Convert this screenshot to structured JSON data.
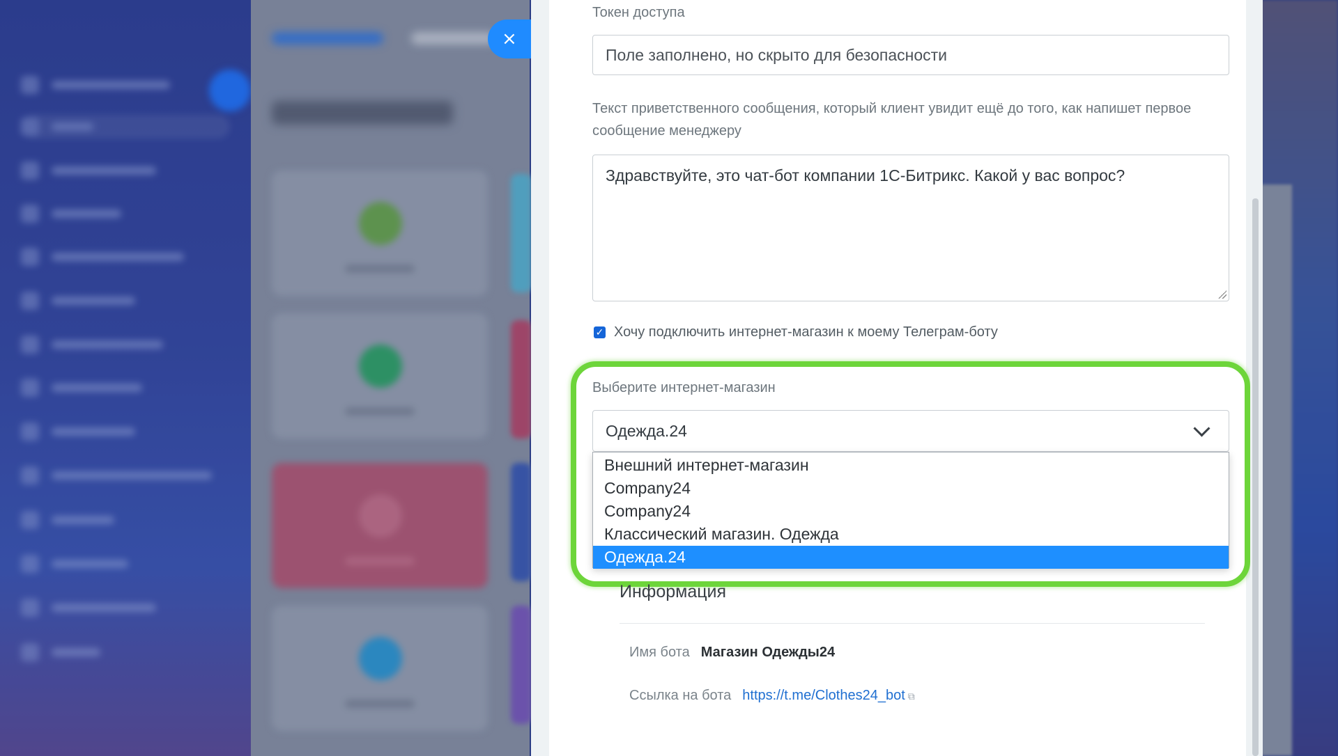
{
  "close_button": {
    "icon": "close-icon",
    "glyph": "×"
  },
  "form": {
    "access_token": {
      "label": "Токен доступа",
      "value": "Поле заполнено, но скрыто для безопасности"
    },
    "welcome": {
      "label_line1": "Текст приветственного сообщения, который клиент увидит ещё до того, как напишет первое",
      "label_line2": "сообщение менеджеру",
      "value": "Здравствуйте, это чат-бот компании 1С-Битрикс. Какой у вас вопрос?"
    },
    "shop_checkbox": {
      "checked": true,
      "label": "Хочу подключить интернет-магазин к моему Телеграм-боту"
    },
    "shop_select": {
      "label": "Выберите интернет-магазин",
      "value": "Одежда.24",
      "options": [
        "Внешний интернет-магазин",
        "Company24",
        "Company24",
        "Классический магазин. Одежда",
        "Одежда.24"
      ],
      "selected_index": 4
    }
  },
  "info": {
    "title": "Информация",
    "bot_name_label": "Имя бота",
    "bot_name_value": "Магазин Одежды24",
    "bot_link_label": "Ссылка на бота",
    "bot_link_value": "https://t.me/Clothes24_bot"
  },
  "colors": {
    "accent": "#1e8fff",
    "highlight": "#6dd53a",
    "checkbox": "#1565d8"
  }
}
